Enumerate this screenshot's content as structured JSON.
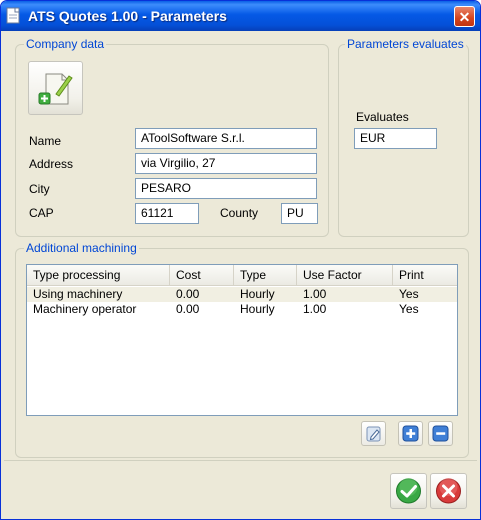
{
  "window": {
    "title": "ATS Quotes 1.00 - Parameters",
    "close_glyph": "✕"
  },
  "company": {
    "group_title": "Company data",
    "name_label": "Name",
    "name_value": "AToolSoftware S.r.l.",
    "address_label": "Address",
    "address_value": "via Virgilio, 27",
    "city_label": "City",
    "city_value": "PESARO",
    "cap_label": "CAP",
    "cap_value": "61121",
    "county_label": "County",
    "county_value": "PU",
    "logo_button_icon": "new-document-icon"
  },
  "params": {
    "group_title": "Parameters evaluates",
    "evaluates_label": "Evaluates",
    "evaluates_value": "EUR"
  },
  "machining": {
    "group_title": "Additional machining",
    "columns": [
      "Type processing",
      "Cost",
      "Type",
      "Use Factor",
      "Print"
    ],
    "rows": [
      [
        "Using machinery",
        "0.00",
        "Hourly",
        "1.00",
        "Yes"
      ],
      [
        "Machinery operator",
        "0.00",
        "Hourly",
        "1.00",
        "Yes"
      ]
    ],
    "edit_icon": "edit-icon",
    "add_icon": "add-icon",
    "remove_icon": "remove-icon"
  },
  "footer": {
    "ok_icon": "checkmark-icon",
    "cancel_icon": "cancel-icon"
  },
  "colors": {
    "group_title": "#0046d5",
    "titlebar": "#0559e6",
    "ok": "#2e9a2e",
    "cancel": "#d42a2a"
  }
}
